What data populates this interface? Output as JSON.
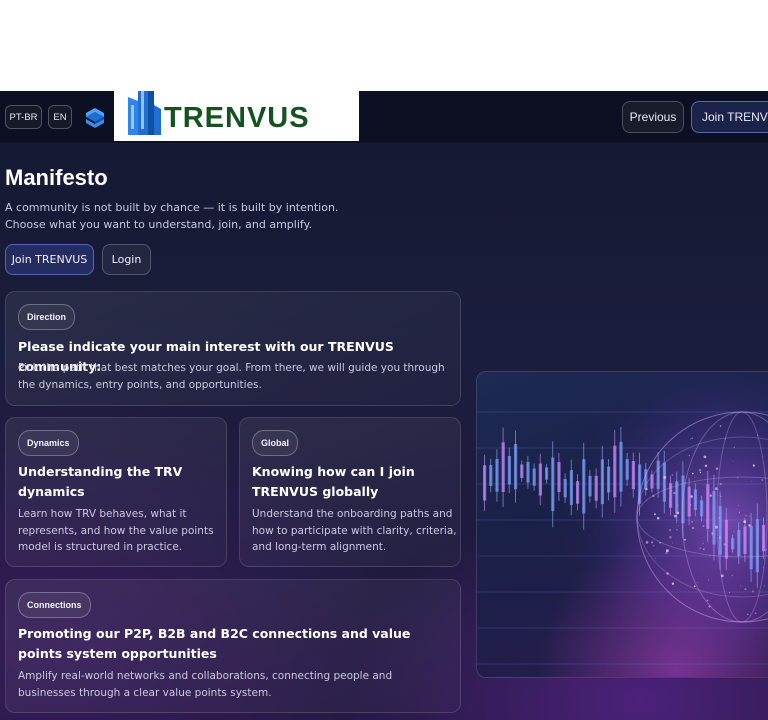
{
  "header": {
    "lang_pt": "PT-BR",
    "lang_en": "EN",
    "brand": "TRENVUS",
    "previous_label": "Previous",
    "join_label": "Join TRENVUS"
  },
  "hero": {
    "title": "Manifesto",
    "description": "A community is not built by chance — it is built by intention. Choose what you want to understand, join, and amplify.",
    "join_label": "Join TRENVUS",
    "login_label": "Login"
  },
  "cards": {
    "direction": {
      "tag": "Direction",
      "title": "Please indicate your main interest with our TRENVUS community:",
      "description": "Pick the path that best matches your goal. From there, we will guide you through the dynamics, entry points, and opportunities."
    },
    "dynamics": {
      "tag": "Dynamics",
      "title": "Understanding the TRV dynamics",
      "description": "Learn how TRV behaves, what it represents, and how the value points model is structured in practice."
    },
    "global": {
      "tag": "Global",
      "title": "Knowing how can I join TRENVUS globally",
      "description": "Understand the onboarding paths and how to participate with clarity, criteria, and long-term alignment."
    },
    "connections": {
      "tag": "Connections",
      "title": "Promoting our P2P, B2B and B2C connections and value points system opportunities",
      "description": "Amplify real-world networks and collaborations, connecting people and businesses through a clear value points system."
    }
  },
  "colors": {
    "background": "#1b1d3c",
    "topbar": "#0d1022",
    "accent": "#5a78ff",
    "brand_green": "#14521f",
    "brand_blue": "#1e6fd0"
  },
  "icons": [
    "trenvus-logo-icon",
    "trenvus-brand-icon",
    "candlestick-chart",
    "globe"
  ]
}
